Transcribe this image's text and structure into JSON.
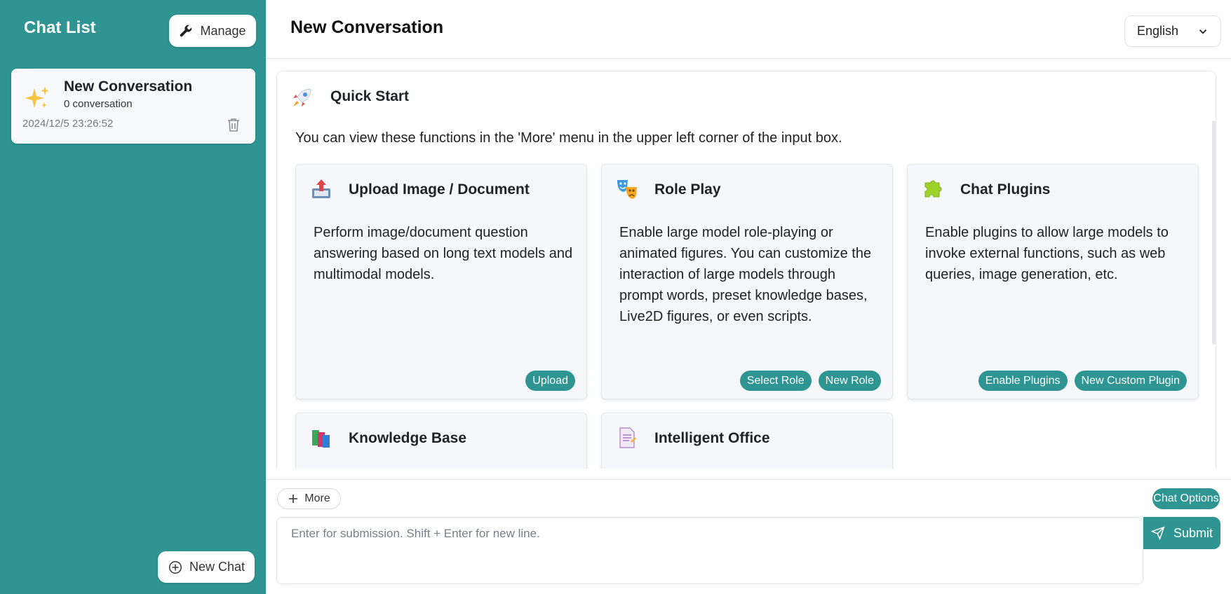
{
  "sidebar": {
    "title": "Chat List",
    "manage_label": "Manage",
    "new_chat_label": "New Chat",
    "chats": [
      {
        "title": "New Conversation",
        "count": "0 conversation",
        "date": "2024/12/5 23:26:52"
      }
    ]
  },
  "header": {
    "title": "New Conversation",
    "language": "English"
  },
  "quick_start": {
    "title": "Quick Start",
    "description": "You can view these functions in the 'More' menu in the upper left corner of the input box.",
    "cards": [
      {
        "icon": "upload-icon",
        "title": "Upload Image / Document",
        "description": "Perform image/document question answering based on long text models and multimodal models.",
        "actions": [
          "Upload"
        ]
      },
      {
        "icon": "theater-masks-icon",
        "title": "Role Play",
        "description": "Enable large model role-playing or animated figures. You can customize the interaction of large models through prompt words, preset knowledge bases, Live2D figures, or even scripts.",
        "actions": [
          "Select Role",
          "New Role"
        ]
      },
      {
        "icon": "puzzle-icon",
        "title": "Chat Plugins",
        "description": "Enable plugins to allow large models to invoke external functions, such as web queries, image generation, etc.",
        "actions": [
          "Enable Plugins",
          "New Custom Plugin"
        ]
      },
      {
        "icon": "books-icon",
        "title": "Knowledge Base"
      },
      {
        "icon": "document-icon",
        "title": "Intelligent Office"
      }
    ]
  },
  "input": {
    "more_label": "More",
    "chat_options_label": "Chat Options",
    "placeholder": "Enter for submission. Shift + Enter for new line.",
    "value": "",
    "submit_label": "Submit"
  },
  "colors": {
    "accent": "#2e9592",
    "card_bg": "#f5f7fa"
  }
}
